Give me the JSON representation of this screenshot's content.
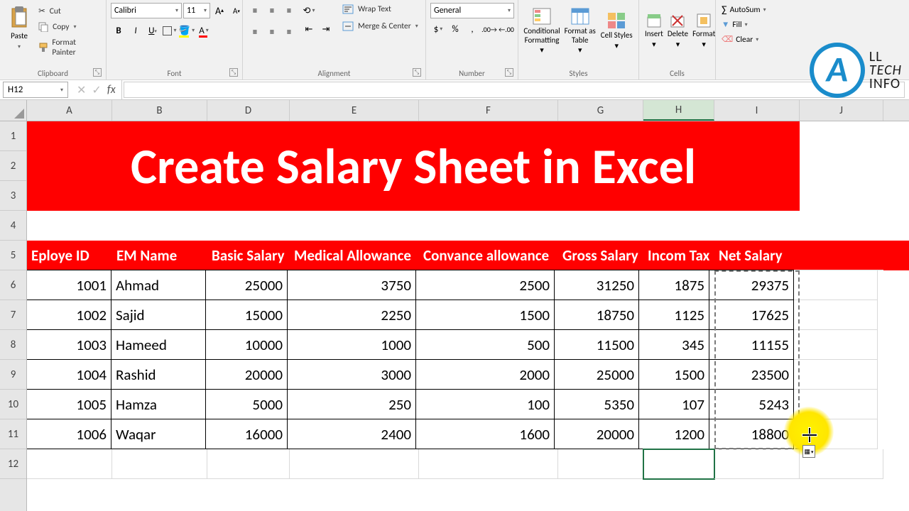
{
  "ribbon": {
    "clipboard": {
      "label": "Clipboard",
      "paste": "Paste",
      "cut": "Cut",
      "copy": "Copy",
      "format_painter": "Format Painter"
    },
    "font": {
      "label": "Font",
      "name": "Calibri",
      "size": "11"
    },
    "alignment": {
      "label": "Alignment",
      "wrap": "Wrap Text",
      "merge": "Merge & Center"
    },
    "number": {
      "label": "Number",
      "format": "General"
    },
    "styles": {
      "label": "Styles",
      "cond": "Conditional Formatting",
      "table": "Format as Table",
      "cell": "Cell Styles"
    },
    "cells": {
      "label": "Cells",
      "insert": "Insert",
      "delete": "Delete",
      "format": "Format"
    },
    "editing": {
      "autosum": "AutoSum",
      "fill": "Fill",
      "clear": "Clear"
    }
  },
  "namebox": "H12",
  "columns": [
    "A",
    "B",
    "D",
    "E",
    "F",
    "G",
    "H",
    "I",
    "J"
  ],
  "rows": [
    "1",
    "2",
    "3",
    "4",
    "5",
    "6",
    "7",
    "8",
    "9",
    "10",
    "11",
    "12"
  ],
  "title": "Create Salary Sheet in Excel",
  "headers": {
    "A": "Eploye ID",
    "B": "EM Name",
    "D": "Basic Salary",
    "E": "Medical Allowance",
    "F": "Convance allowance",
    "G": "Gross Salary",
    "H": "Incom Tax",
    "I": "Net Salary"
  },
  "data": [
    {
      "A": "1001",
      "B": "Ahmad",
      "D": "25000",
      "E": "3750",
      "F": "2500",
      "G": "31250",
      "H": "1875",
      "I": "29375"
    },
    {
      "A": "1002",
      "B": "Sajid",
      "D": "15000",
      "E": "2250",
      "F": "1500",
      "G": "18750",
      "H": "1125",
      "I": "17625"
    },
    {
      "A": "1003",
      "B": "Hameed",
      "D": "10000",
      "E": "1000",
      "F": "500",
      "G": "11500",
      "H": "345",
      "I": "11155"
    },
    {
      "A": "1004",
      "B": "Rashid",
      "D": "20000",
      "E": "3000",
      "F": "2000",
      "G": "25000",
      "H": "1500",
      "I": "23500"
    },
    {
      "A": "1005",
      "B": "Hamza",
      "D": "5000",
      "E": "250",
      "F": "100",
      "G": "5350",
      "H": "107",
      "I": "5243"
    },
    {
      "A": "1006",
      "B": "Waqar",
      "D": "16000",
      "E": "2400",
      "F": "1600",
      "G": "20000",
      "H": "1200",
      "I": "18800"
    }
  ],
  "logo": {
    "line1": "LL",
    "line2": "TECH",
    "line3": "INFO"
  }
}
